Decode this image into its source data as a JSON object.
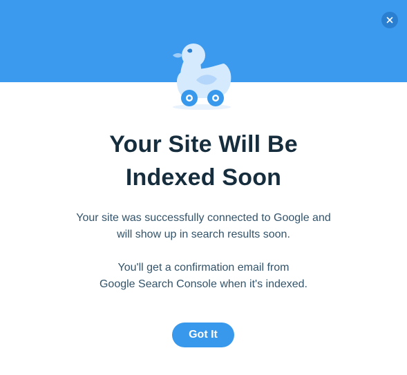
{
  "dialog": {
    "title_line1": "Your Site Will Be",
    "title_line2": "Indexed Soon",
    "paragraph1_line1": "Your site was successfully connected to Google and",
    "paragraph1_line2": "will show up in search results soon.",
    "paragraph2_line1": "You'll get a confirmation email from",
    "paragraph2_line2": "Google Search Console when it's indexed.",
    "primary_button_label": "Got It",
    "close_icon": "close-icon",
    "illustration_icon": "duck-on-wheels-icon"
  },
  "colors": {
    "header_band": "#3b99ee",
    "close_button_bg": "#2a7fd0",
    "primary_button": "#3899ec",
    "title_text": "#162d3d",
    "body_text": "#32536a"
  }
}
